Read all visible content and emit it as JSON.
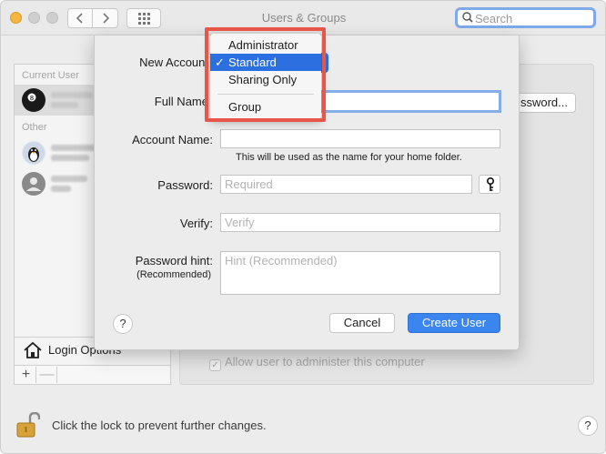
{
  "window": {
    "title": "Users & Groups",
    "search_placeholder": "Search"
  },
  "sidebar": {
    "current_user_label": "Current User",
    "other_users_label": "Other",
    "login_options_label": "Login Options",
    "add_symbol": "+",
    "remove_symbol": "—"
  },
  "main": {
    "change_password_partial": "ssword...",
    "allow_admin_label": "Allow user to administer this computer"
  },
  "footer": {
    "lock_text": "Click the lock to prevent further changes.",
    "help_symbol": "?"
  },
  "sheet": {
    "new_account_label": "New Account",
    "full_name_label": "Full Name",
    "account_name_label": "Account Name:",
    "account_name_hint": "This will be used as the name for your home folder.",
    "password_label": "Password:",
    "password_placeholder": "Required",
    "verify_label": "Verify:",
    "verify_placeholder": "Verify",
    "password_hint_label": "Password hint:",
    "password_hint_sub": "(Recommended)",
    "password_hint_placeholder": "Hint (Recommended)",
    "help_symbol": "?",
    "cancel_label": "Cancel",
    "create_label": "Create User"
  },
  "account_type_menu": {
    "items": [
      {
        "label": "Administrator",
        "selected": false
      },
      {
        "label": "Standard",
        "selected": true
      },
      {
        "label": "Sharing Only",
        "selected": false
      },
      {
        "label": "Group",
        "selected": false
      }
    ],
    "check_mark": "✓"
  },
  "colors": {
    "accent": "#3a86ee",
    "menu_highlight": "#2b6fe0",
    "annotation_border": "#e8564a"
  }
}
